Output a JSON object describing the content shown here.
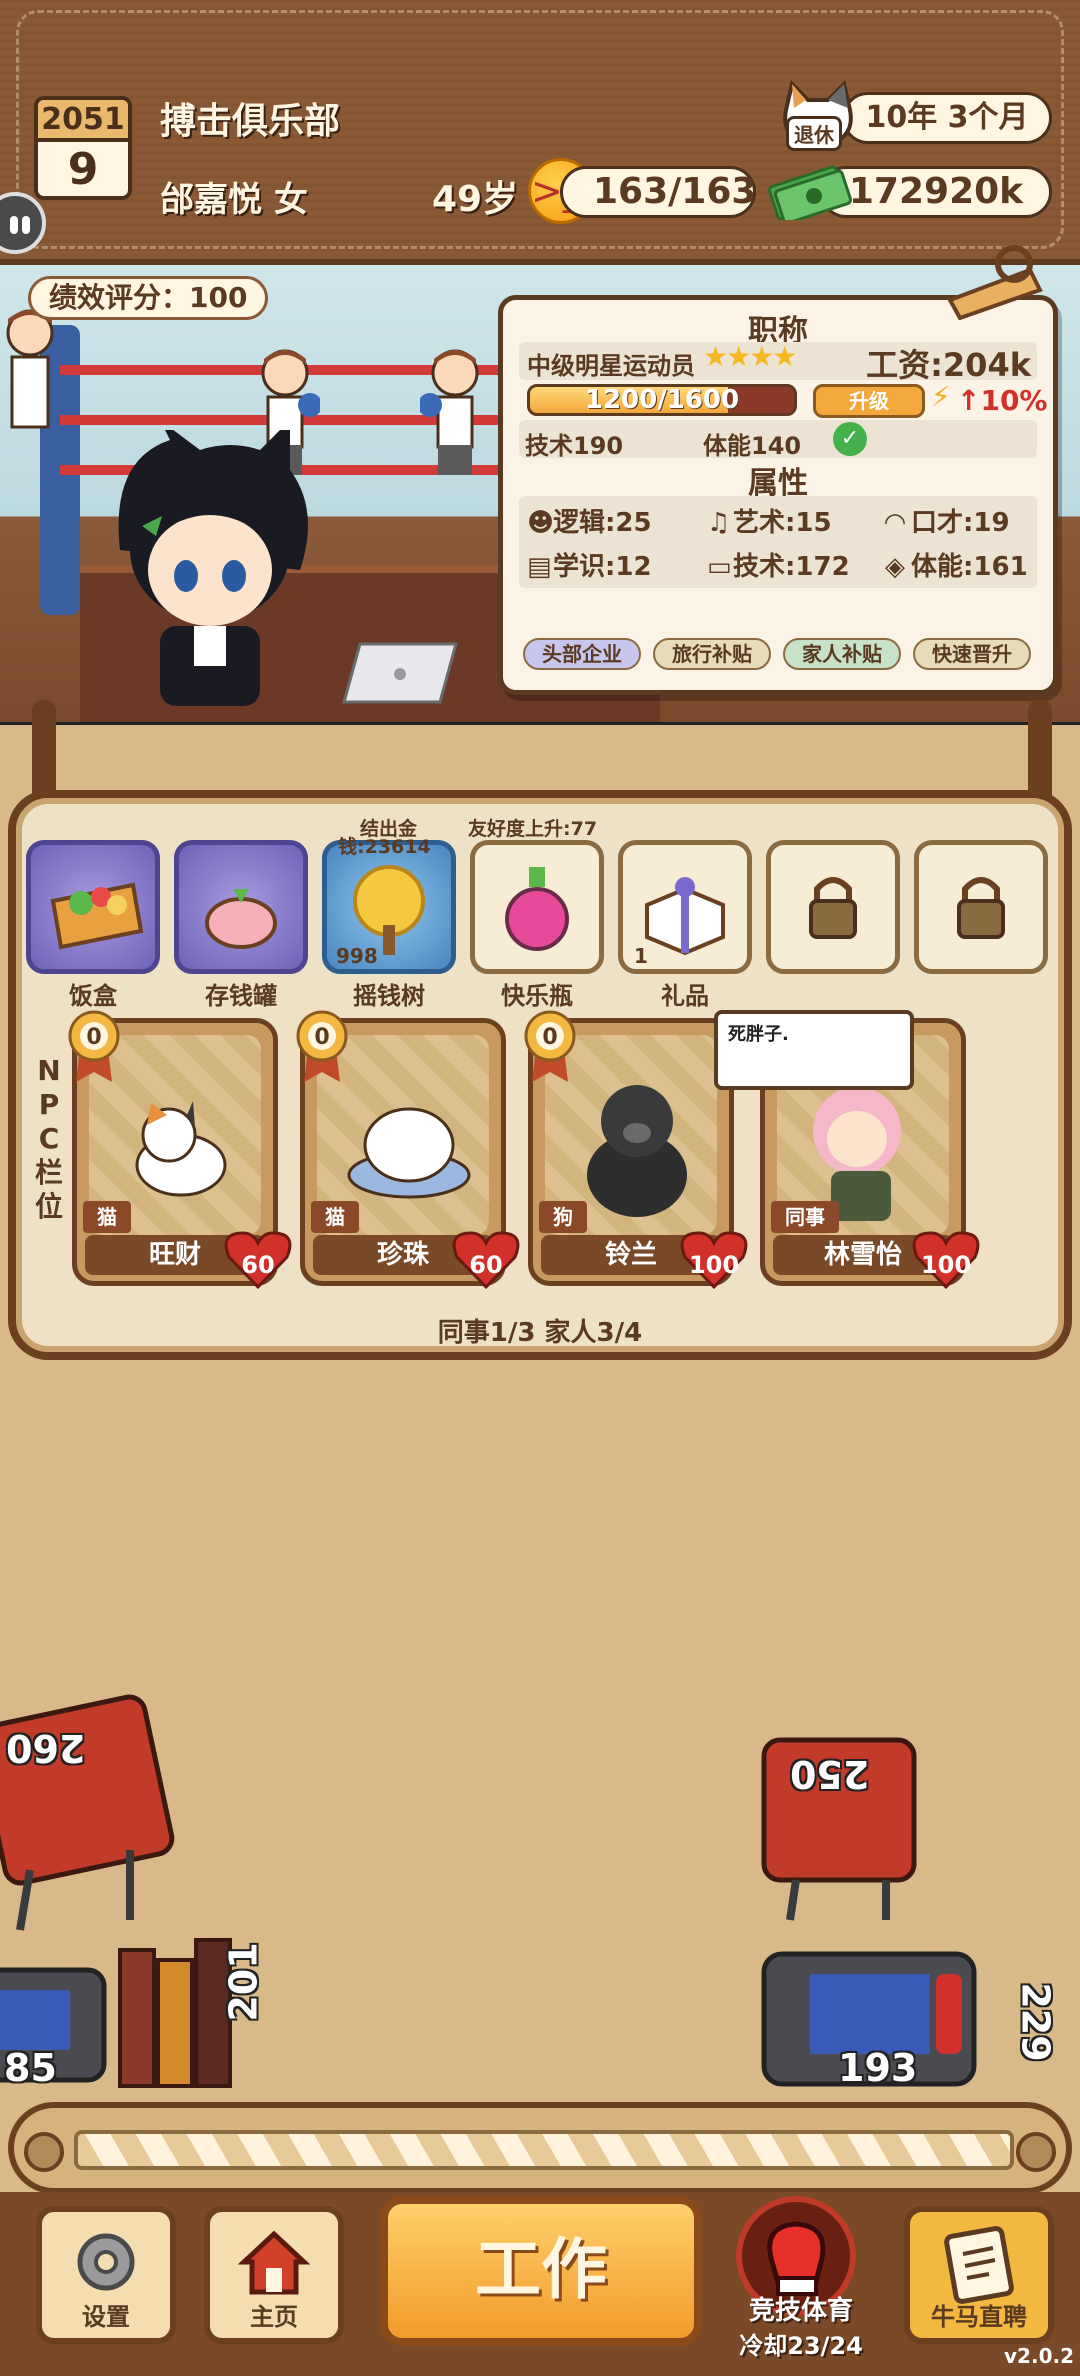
{
  "header": {
    "year": "2051",
    "day": "9",
    "club_name": "搏击俱乐部",
    "player": "邰嘉悦 女",
    "age": "49岁",
    "mood": "163/163",
    "money": "172920k",
    "retire_label": "退休",
    "retire_time": "10年  3个月"
  },
  "scene": {
    "performance": "绩效评分：100"
  },
  "job": {
    "title": "职称",
    "rank": "中级明星运动员",
    "stars": "★★★★",
    "salary": "工资:204k",
    "xp": "1200/1600",
    "xp_progress": 0.75,
    "upgrade": "升级",
    "bonus": "↑10%",
    "req_skill": "技术190",
    "req_stamina": "体能140",
    "attributes_title": "属性",
    "attributes": [
      {
        "icon": "brain-icon",
        "glyph": "☻",
        "label": "逻辑:25"
      },
      {
        "icon": "music-icon",
        "glyph": "♫",
        "label": "艺术:15"
      },
      {
        "icon": "mouth-icon",
        "glyph": "◠",
        "label": "口才:19"
      },
      {
        "icon": "book-icon",
        "glyph": "▤",
        "label": "学识:12"
      },
      {
        "icon": "monitor-icon",
        "glyph": "▭",
        "label": "技术:172"
      },
      {
        "icon": "shield-icon",
        "glyph": "◈",
        "label": "体能:161"
      }
    ],
    "tags": [
      {
        "label": "头部企业",
        "color": "#c8c6ee"
      },
      {
        "label": "旅行补贴",
        "color": "#e8dcb8"
      },
      {
        "label": "家人补贴",
        "color": "#c8e2c8"
      },
      {
        "label": "快速晋升",
        "color": "#e8dcb8"
      }
    ]
  },
  "items": {
    "notes": {
      "settle": "结出金",
      "friend": "友好度上升:77",
      "tree_money": "钱:23614",
      "tree_count": "998",
      "gift_count": "1"
    },
    "slots": [
      {
        "label": "饭盒",
        "icon": "bento-box-icon"
      },
      {
        "label": "存钱罐",
        "icon": "piggy-bank-icon"
      },
      {
        "label": "摇钱树",
        "icon": "money-tree-icon"
      },
      {
        "label": "快乐瓶",
        "icon": "potion-bottle-icon"
      },
      {
        "label": "礼品",
        "icon": "gift-box-icon"
      },
      {
        "label": "",
        "icon": "lock-icon"
      },
      {
        "label": "",
        "icon": "lock-icon"
      }
    ]
  },
  "npc": {
    "side_label": [
      "N",
      "P",
      "C",
      "栏",
      "位"
    ],
    "cards": [
      {
        "name": "旺财",
        "type": "猫",
        "affinity": "60",
        "medal": "0"
      },
      {
        "name": "珍珠",
        "type": "猫",
        "affinity": "60",
        "medal": "0"
      },
      {
        "name": "铃兰",
        "type": "狗",
        "affinity": "100",
        "medal": "0"
      },
      {
        "name": "林雪怡",
        "type": "同事",
        "affinity": "100",
        "medal": ""
      }
    ],
    "speech": "死胖子.",
    "summary": "同事1/3 家人3/4"
  },
  "room": {
    "items": [
      "260",
      "250",
      "85",
      "201",
      "193",
      "229"
    ]
  },
  "nav": {
    "settings": "设置",
    "home": "主页",
    "work": "工作",
    "sport": "竞技体育",
    "cooldown": "冷却23/24",
    "hire": "牛马直聘",
    "version": "v2.0.2"
  },
  "colors": {
    "accent": "#f29b2a",
    "wood": "#6a4020",
    "panel": "#efe1c6"
  }
}
